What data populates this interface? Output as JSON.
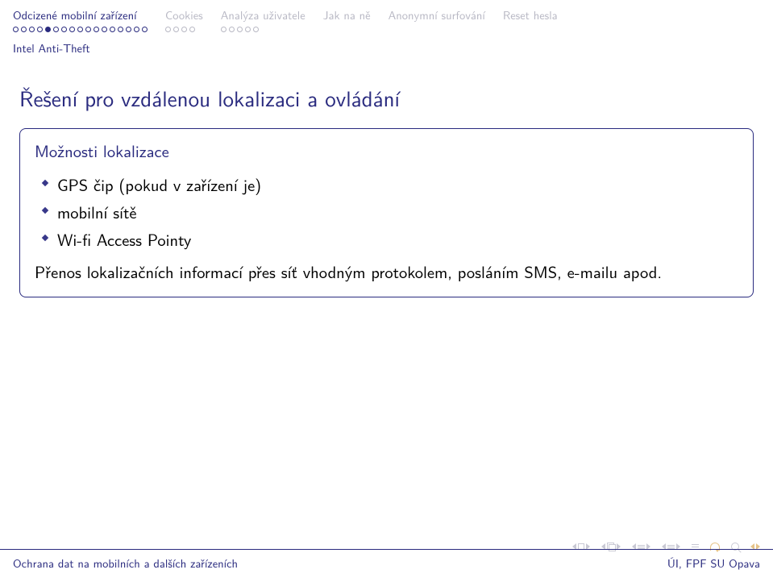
{
  "nav": {
    "sections": [
      {
        "label": "Odcizené mobilní zařízení",
        "current": true,
        "dots": 17,
        "here_index": 4
      },
      {
        "label": "Cookies",
        "current": false,
        "dots": 4,
        "here_index": -1
      },
      {
        "label": "Analýza uživatele",
        "current": false,
        "dots": 5,
        "here_index": -1
      },
      {
        "label": "Jak na ně",
        "current": false,
        "dots": 0,
        "here_index": -1
      },
      {
        "label": "Anonymní surfování",
        "current": false,
        "dots": 0,
        "here_index": -1
      },
      {
        "label": "Reset hesla",
        "current": false,
        "dots": 0,
        "here_index": -1
      }
    ],
    "subsection": "Intel Anti-Theft"
  },
  "frametitle": "Řešení pro vzdálenou lokalizaci a ovládání",
  "block": {
    "title": "Možnosti lokalizace",
    "items": [
      "GPS čip (pokud v zařízení je)",
      "mobilní sítě",
      "Wi-fi Access Pointy"
    ],
    "para": "Přenos lokalizačních informací přes síť vhodným protokolem, posláním SMS, e-mailu apod."
  },
  "footer": {
    "left": "Ochrana dat na mobilních a dalších zařízeních",
    "right": "ÚI, FPF SU Opava"
  }
}
